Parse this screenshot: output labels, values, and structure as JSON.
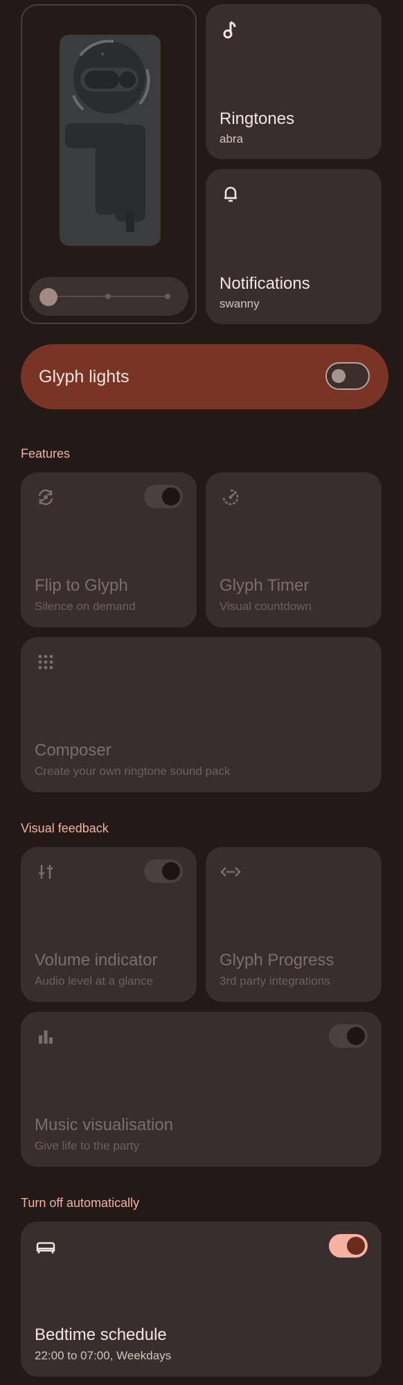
{
  "ringtones": {
    "title": "Ringtones",
    "subtitle": "abra",
    "icon": "music-note-icon"
  },
  "notifications": {
    "title": "Notifications",
    "subtitle": "swanny",
    "icon": "bell-icon"
  },
  "glyph_lights": {
    "label": "Glyph lights",
    "enabled": false
  },
  "sections": {
    "features": "Features",
    "visual_feedback": "Visual feedback",
    "turn_off": "Turn off automatically"
  },
  "features": {
    "flip": {
      "title": "Flip to Glyph",
      "subtitle": "Silence on demand",
      "icon": "flip-icon",
      "enabled": true
    },
    "timer": {
      "title": "Glyph Timer",
      "subtitle": "Visual countdown",
      "icon": "timer-icon"
    },
    "composer": {
      "title": "Composer",
      "subtitle": "Create your own ringtone sound pack",
      "icon": "grid-dots-icon"
    }
  },
  "visual": {
    "volume": {
      "title": "Volume indicator",
      "subtitle": "Audio level at a glance",
      "icon": "sliders-icon",
      "enabled": true
    },
    "progress": {
      "title": "Glyph Progress",
      "subtitle": "3rd party integrations",
      "icon": "code-arrows-icon"
    },
    "music": {
      "title": "Music visualisation",
      "subtitle": "Give life to the party",
      "icon": "bar-chart-icon",
      "enabled": true
    }
  },
  "bedtime": {
    "title": "Bedtime schedule",
    "subtitle": "22:00 to 07:00, Weekdays",
    "icon": "bed-icon",
    "enabled": true
  },
  "colors": {
    "accent": "#f6b1a1",
    "glyph_bar": "#7a3426",
    "tile": "#382e2c",
    "background": "#231a18"
  }
}
